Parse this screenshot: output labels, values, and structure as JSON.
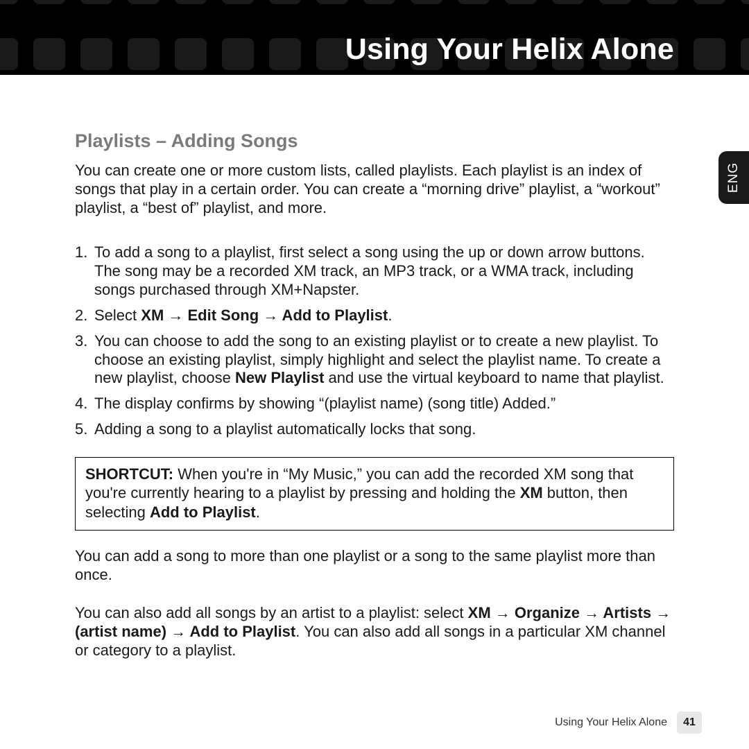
{
  "header": {
    "title": "Using Your Helix Alone"
  },
  "lang_tab": "ENG",
  "section": {
    "heading": "Playlists – Adding Songs",
    "intro": "You can create one or more custom lists, called playlists. Each playlist is an index of songs that play in a certain order. You can create a “morning drive” playlist, a “workout” playlist, a “best of” playlist, and more.",
    "steps": {
      "s1": "To add a song to a playlist, first select a song using the up or down arrow buttons. The song may be a recorded XM track, an MP3 track, or a WMA track, including songs purchased through XM+Napster.",
      "s2_pre": "Select ",
      "s2_bold": "XM → Edit Song → Add to Playlist",
      "s2_post": ".",
      "s3_a": "You can choose to add the song to an existing playlist or to create a new playlist. To choose an existing playlist, simply highlight and select the playlist name. To create a new playlist, choose ",
      "s3_b": "New Playlist",
      "s3_c": " and use the virtual keyboard to name that playlist.",
      "s4": "The display confirms by showing “(playlist name) (song title) Added.”",
      "s5": "Adding a song to a playlist automatically locks that song."
    },
    "shortcut": {
      "label": "SHORTCUT:",
      "a": " When you're in “My Music,” you can add the recorded XM song that you're currently hearing to a playlist by pressing and holding the ",
      "b": "XM",
      "c": " button, then selecting ",
      "d": "Add to Playlist",
      "e": "."
    },
    "p2": "You can add a song to more than one playlist or a song to the same playlist more than once.",
    "p3": {
      "a": "You can also add all songs by an artist to a playlist: select ",
      "b": "XM → Organize → Artists → (artist name) → Add to Playlist",
      "c": ". You can also add all songs in a particular XM channel or category to a playlist."
    }
  },
  "footer": {
    "label": "Using Your Helix Alone",
    "page": "41"
  }
}
